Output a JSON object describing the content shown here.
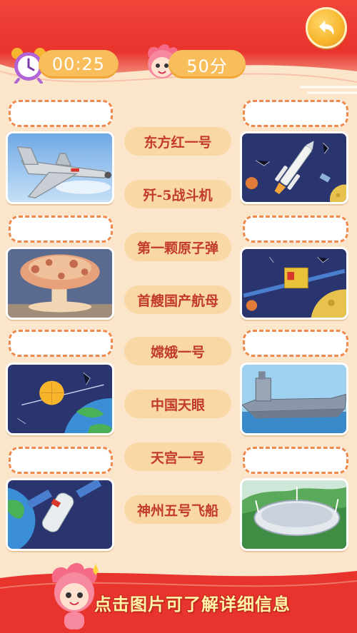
{
  "timer": {
    "value": "00:25"
  },
  "score": {
    "value": "50分"
  },
  "labels": [
    "东方红一号",
    "歼-5战斗机",
    "第一颗原子弹",
    "首艘国产航母",
    "嫦娥一号",
    "中国天眼",
    "天宫一号",
    "神州五号飞船"
  ],
  "cards": {
    "left": [
      "fighter-jet-image",
      "mushroom-cloud-image",
      "satellite-earth-image",
      "space-station-image"
    ],
    "right": [
      "rocket-image",
      "lunar-orbiter-image",
      "aircraft-carrier-image",
      "radio-telescope-image"
    ]
  },
  "hint": {
    "text": "点击图片可了解详细信息"
  },
  "colors": {
    "header_red": "#e9332d",
    "page_bg": "#fbe6cb",
    "pill_orange": "#f9be5c",
    "label_bg": "#f9d8a6",
    "label_text": "#c23a2a",
    "dash_orange": "#ef8a4c"
  }
}
